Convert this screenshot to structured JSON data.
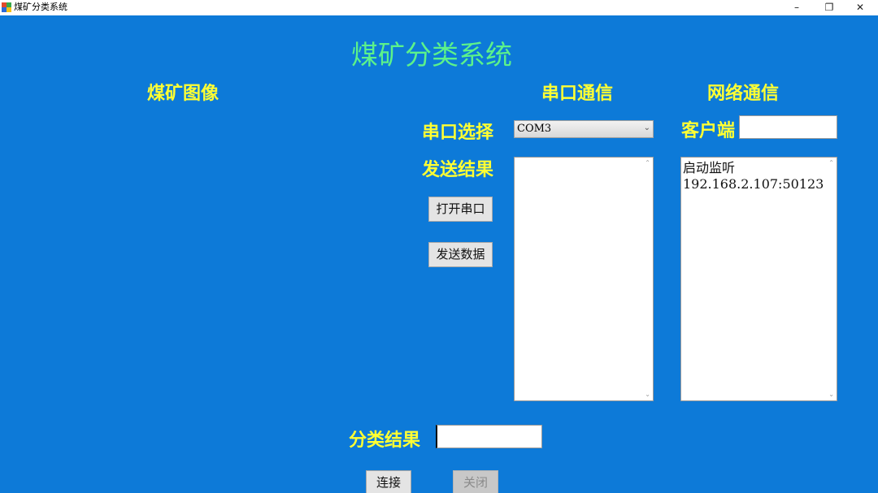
{
  "window": {
    "title": "煤矿分类系统",
    "controls": {
      "minimize": "–",
      "maximize": "❐",
      "close": "✕"
    }
  },
  "main": {
    "title": "煤矿分类系统",
    "image_panel_label": "煤矿图像"
  },
  "serial": {
    "heading": "串口通信",
    "port_label": "串口选择",
    "port_value": "COM3",
    "send_result_label": "发送结果",
    "open_button": "打开串口",
    "send_button": "发送数据",
    "send_result_text": ""
  },
  "network": {
    "heading": "网络通信",
    "client_label": "客户端",
    "client_value": "",
    "log_text": "启动监听\n192.168.2.107:50123"
  },
  "classification": {
    "label": "分类结果",
    "value": "",
    "connect_button": "连接",
    "close_button": "关闭"
  },
  "colors": {
    "background": "#0d7ad8",
    "title_color": "#5cf28a",
    "label_color": "#ffff33"
  }
}
